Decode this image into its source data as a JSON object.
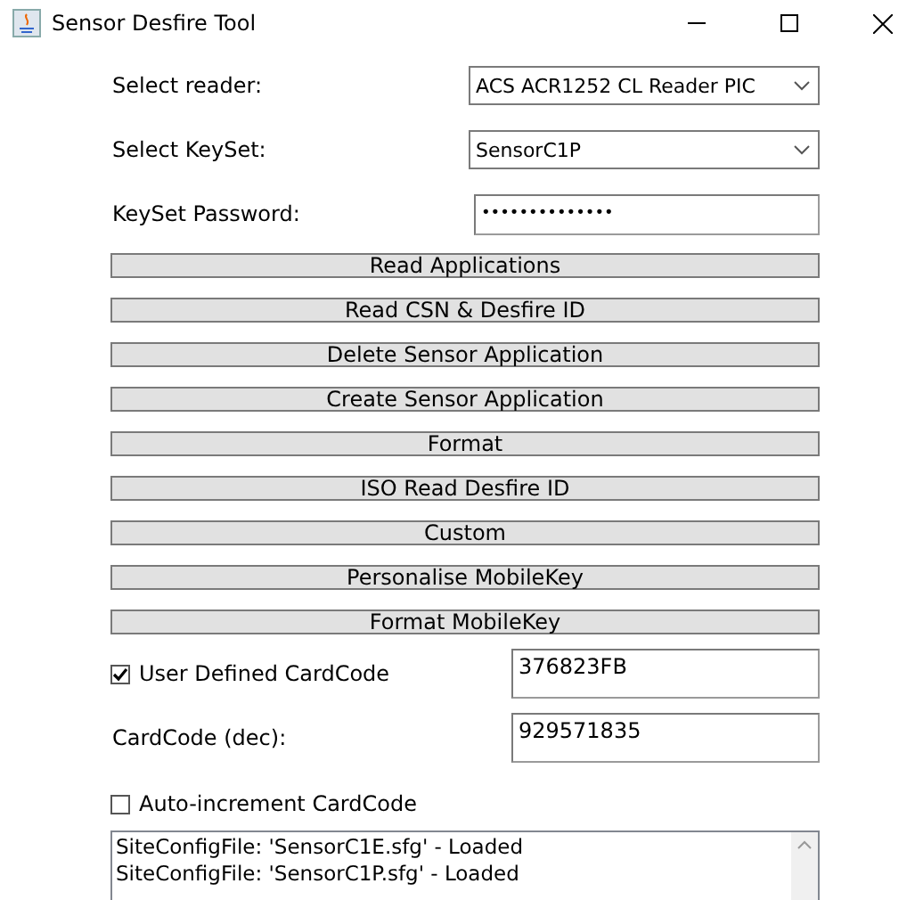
{
  "window": {
    "title": "Sensor Desfire Tool"
  },
  "reader": {
    "label": "Select reader:",
    "value": "ACS ACR1252 CL Reader PIC"
  },
  "keyset": {
    "label": "Select KeySet:",
    "value": "SensorC1P"
  },
  "password": {
    "label": "KeySet Password:",
    "value": "••••••••••••••"
  },
  "buttons": [
    "Read Applications",
    "Read CSN & Desfire ID",
    "Delete Sensor Application",
    "Create Sensor Application",
    "Format",
    "ISO Read Desfire ID",
    "Custom",
    "Personalise MobileKey",
    "Format MobileKey"
  ],
  "user_defined": {
    "label": "User Defined CardCode",
    "checked": true,
    "value": "376823FB"
  },
  "cardcode_dec": {
    "label": "CardCode (dec):",
    "value": "929571835"
  },
  "auto_increment": {
    "label": "Auto-increment CardCode",
    "checked": false
  },
  "log": [
    "SiteConfigFile: 'SensorC1E.sfg' - Loaded",
    "SiteConfigFile: 'SensorC1P.sfg' - Loaded"
  ]
}
